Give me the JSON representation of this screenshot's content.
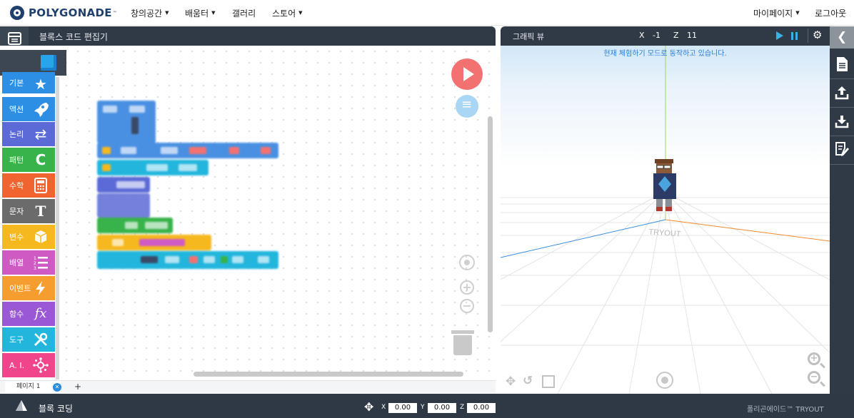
{
  "brand": {
    "name": "POLYGONADE",
    "tm": "™"
  },
  "nav": {
    "menus": [
      {
        "label": "창의공간"
      },
      {
        "label": "배움터"
      },
      {
        "label": "갤러리"
      },
      {
        "label": "스토어"
      }
    ],
    "mypage": "마이페이지",
    "logout": "로그아웃"
  },
  "editor": {
    "title": "블록스 코드 편집기",
    "categories": [
      {
        "label": "기본",
        "icon": "star-icon",
        "color": "#2d8fe3"
      },
      {
        "label": "액션",
        "icon": "rocket-icon",
        "color": "#2d8fe3"
      },
      {
        "label": "논리",
        "icon": "shuffle-icon",
        "color": "#5b6ad6"
      },
      {
        "label": "패턴",
        "icon": "loop-arrow-icon",
        "color": "#37b34a"
      },
      {
        "label": "수학",
        "icon": "calculator-icon",
        "color": "#f0642f"
      },
      {
        "label": "문자",
        "icon": "text-t-icon",
        "color": "#6b6b6b"
      },
      {
        "label": "변수",
        "icon": "box-icon",
        "color": "#f5b81e"
      },
      {
        "label": "배열",
        "icon": "numbered-list-icon",
        "color": "#d05ac4"
      },
      {
        "label": "이벤트",
        "icon": "lightning-icon",
        "color": "#f59d2f"
      },
      {
        "label": "함수",
        "icon": "fx-icon",
        "color": "#9b58d6"
      },
      {
        "label": "도구",
        "icon": "tools-icon",
        "color": "#22b6dd"
      },
      {
        "label": "A. I.",
        "icon": "network-icon",
        "color": "#f0458b"
      }
    ],
    "page_tab": "페이지 1",
    "add_page": "+"
  },
  "graphics": {
    "title": "그래픽 뷰",
    "x_label": "X",
    "x_value": "-1",
    "z_label": "Z",
    "z_value": "11",
    "trial_notice": "현재 체험하기 모드로 동작하고 있습니다.",
    "ground_label": "TRYOUT"
  },
  "bottom": {
    "title": "블록 코딩",
    "x_label": "X",
    "x_value": "0.00",
    "y_label": "Y",
    "y_value": "0.00",
    "z_label": "Z",
    "z_value": "0.00",
    "brand": "폴리곤에이드™ TRYOUT"
  }
}
